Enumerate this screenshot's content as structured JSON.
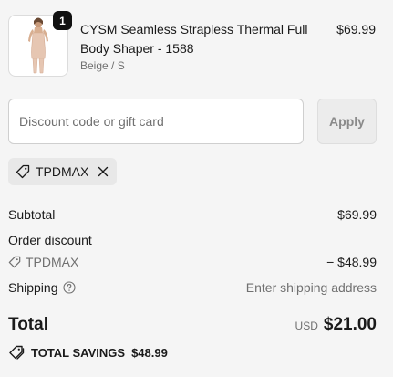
{
  "product": {
    "quantity": "1",
    "title": "CYSM Seamless Strapless Thermal Full Body Shaper - 1588",
    "variant": "Beige / S",
    "price": "$69.99",
    "thumbnail_icon": "bodysuit-product-image"
  },
  "discount": {
    "placeholder": "Discount code or gift card",
    "value": "",
    "apply_label": "Apply",
    "applied_code": "TPDMAX"
  },
  "summary": {
    "subtotal_label": "Subtotal",
    "subtotal_value": "$69.99",
    "order_discount_label": "Order discount",
    "discount_code": "TPDMAX",
    "discount_value": "− $48.99",
    "shipping_label": "Shipping",
    "shipping_value": "Enter shipping address",
    "total_label": "Total",
    "currency": "USD",
    "total_value": "$21.00",
    "savings_label": "TOTAL SAVINGS",
    "savings_value": "$48.99"
  },
  "colors": {
    "background": "#f5f5f5",
    "text": "#1a1a1a",
    "muted": "#707070",
    "badge": "#111111"
  }
}
